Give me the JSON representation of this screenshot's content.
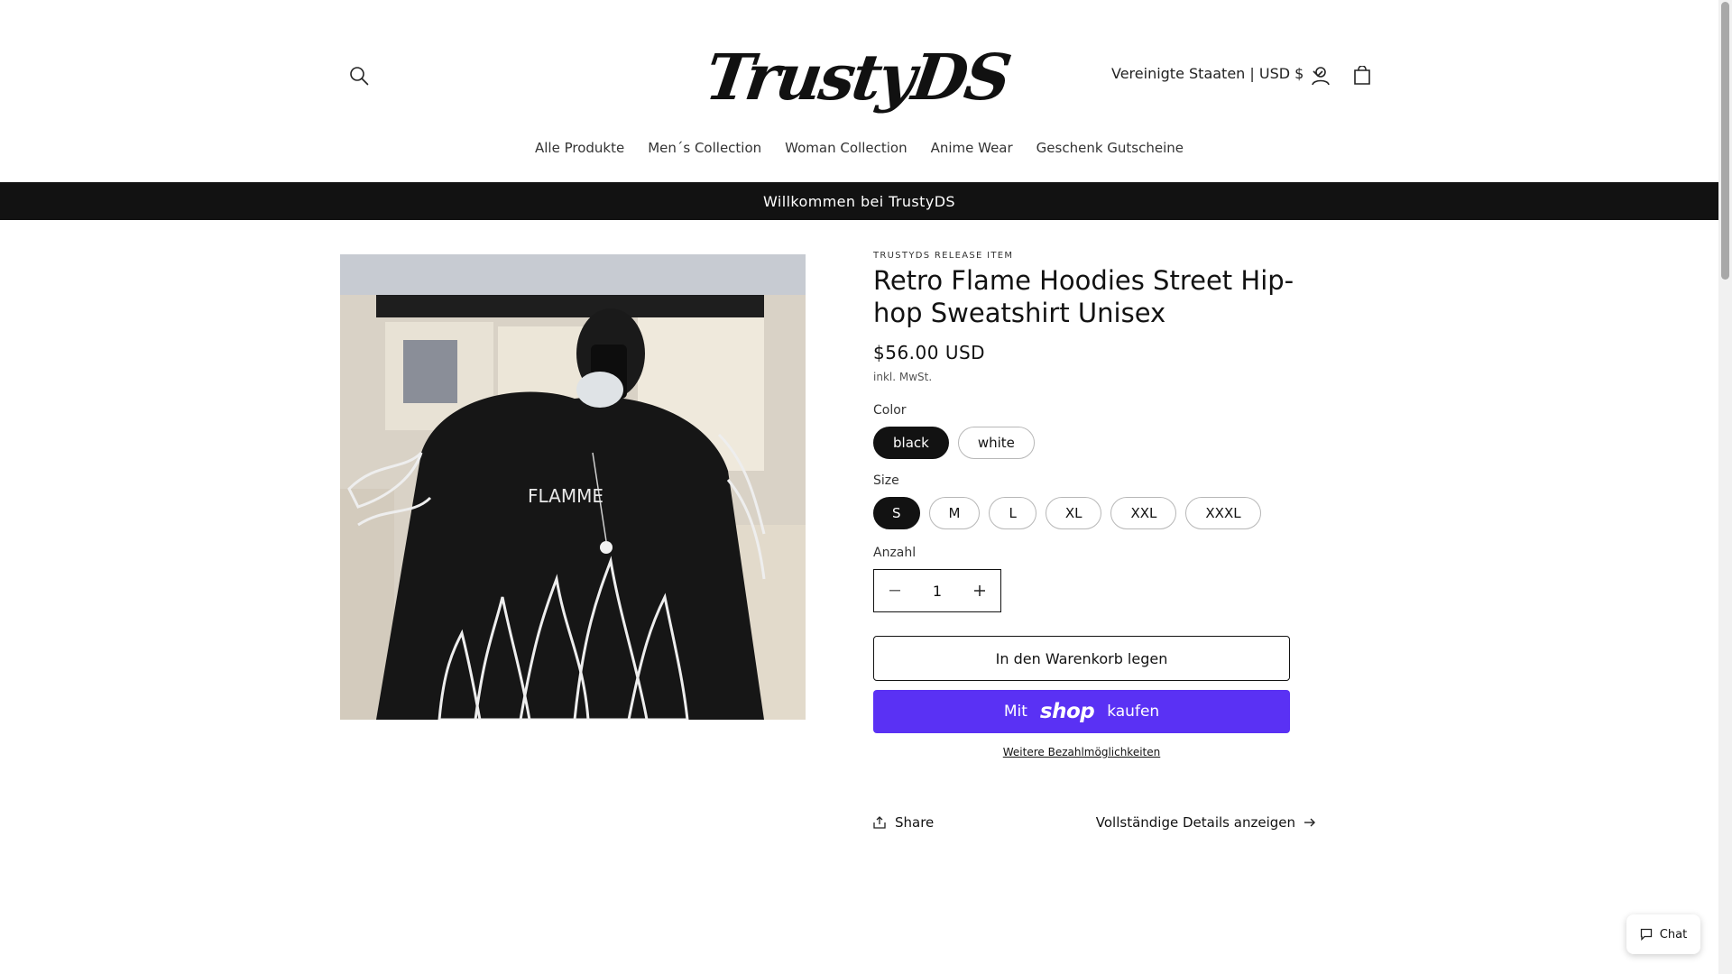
{
  "header": {
    "logo_text": "TrustyDS",
    "country_selector": "Vereinigte Staaten | USD $",
    "icons": [
      "search-icon",
      "account-icon",
      "cart-icon",
      "chevron-down-icon"
    ]
  },
  "nav": {
    "items": [
      {
        "label": "Alle Produkte"
      },
      {
        "label": "Men´s Collection"
      },
      {
        "label": "Woman Collection"
      },
      {
        "label": "Anime Wear"
      },
      {
        "label": "Geschenk Gutscheine"
      }
    ]
  },
  "announcement": "Willkommen bei TrustyDS",
  "product": {
    "vendor": "TRUSTYDS RELEASE ITEM",
    "title": "Retro Flame Hoodies Street Hip-hop Sweatshirt Unisex",
    "price": "$56.00 USD",
    "tax_note": "inkl. MwSt.",
    "color_label": "Color",
    "colors": [
      {
        "label": "black",
        "selected": true
      },
      {
        "label": "white",
        "selected": false
      }
    ],
    "size_label": "Size",
    "sizes": [
      {
        "label": "S",
        "selected": true
      },
      {
        "label": "M",
        "selected": false
      },
      {
        "label": "L",
        "selected": false
      },
      {
        "label": "XL",
        "selected": false
      },
      {
        "label": "XXL",
        "selected": false
      },
      {
        "label": "XXXL",
        "selected": false
      }
    ],
    "quantity_label": "Anzahl",
    "quantity_value": "1",
    "add_to_cart": "In den Warenkorb legen",
    "shop_pay_prefix": "Mit",
    "shop_pay_brand": "shop",
    "shop_pay_suffix": "kaufen",
    "more_payment": "Weitere Bezahlmöglichkeiten",
    "share": "Share",
    "full_details": "Vollständige Details anzeigen",
    "image_print_text": "FLAMME"
  },
  "chat": {
    "label": "Chat"
  },
  "colors": {
    "announcement_bg": "#121212",
    "shop_pay": "#5a31f4",
    "text": "#121212"
  }
}
